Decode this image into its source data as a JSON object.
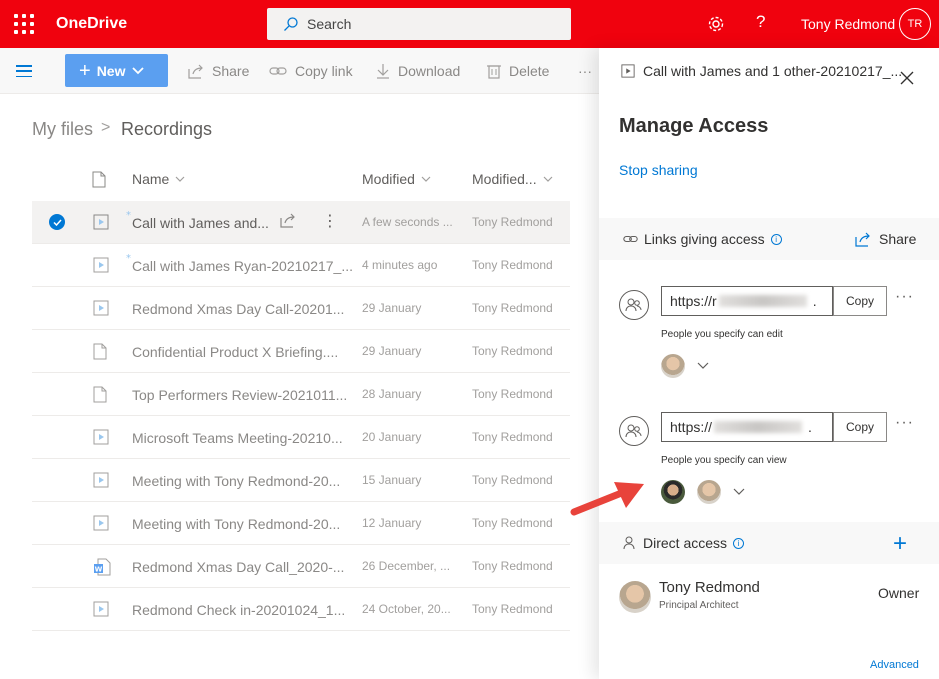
{
  "header": {
    "app_name": "OneDrive",
    "search_placeholder": "Search",
    "user_name": "Tony Redmond",
    "user_initials": "TR",
    "brand_color": "#f0020e"
  },
  "commandbar": {
    "new_label": "New",
    "share_label": "Share",
    "copy_link_label": "Copy link",
    "download_label": "Download",
    "delete_label": "Delete",
    "more_label": "···"
  },
  "breadcrumb": {
    "root": "My files",
    "separator": ">",
    "current": "Recordings"
  },
  "list": {
    "columns": {
      "name": "Name",
      "modified": "Modified",
      "modified_by": "Modified..."
    },
    "rows": [
      {
        "name": "Call with James and...",
        "modified": "A few seconds ...",
        "modified_by": "Tony Redmond",
        "icon": "video-file-icon",
        "selected": true
      },
      {
        "name": "Call with James Ryan-20210217_...",
        "modified": "4 minutes ago",
        "modified_by": "Tony Redmond",
        "icon": "video-file-icon"
      },
      {
        "name": "Redmond Xmas Day Call-20201...",
        "modified": "29 January",
        "modified_by": "Tony Redmond",
        "icon": "video-file-icon"
      },
      {
        "name": "Confidential Product X Briefing....",
        "modified": "29 January",
        "modified_by": "Tony Redmond",
        "icon": "document-file-icon"
      },
      {
        "name": "Top Performers Review-2021011...",
        "modified": "28 January",
        "modified_by": "Tony Redmond",
        "icon": "document-file-icon"
      },
      {
        "name": "Microsoft Teams Meeting-20210...",
        "modified": "20 January",
        "modified_by": "Tony Redmond",
        "icon": "video-file-icon"
      },
      {
        "name": "Meeting with Tony Redmond-20...",
        "modified": "15 January",
        "modified_by": "Tony Redmond",
        "icon": "video-file-icon"
      },
      {
        "name": "Meeting with Tony Redmond-20...",
        "modified": "12 January",
        "modified_by": "Tony Redmond",
        "icon": "video-file-icon"
      },
      {
        "name": "Redmond Xmas Day Call_2020-...",
        "modified": "26 December, ...",
        "modified_by": "Tony Redmond",
        "icon": "word-file-icon"
      },
      {
        "name": "Redmond Check in-20201024_1...",
        "modified": "24 October, 20...",
        "modified_by": "Tony Redmond",
        "icon": "video-file-icon"
      }
    ]
  },
  "panel": {
    "file_name": "Call with James and 1 other-20210217_...",
    "title": "Manage Access",
    "stop_sharing": "Stop sharing",
    "links_section": "Links giving access",
    "info_glyph": "i",
    "share_label": "Share",
    "links": [
      {
        "url_prefix": "https://r",
        "copy_label": "Copy",
        "description": "People you specify can edit",
        "more": "···"
      },
      {
        "url_prefix": "https://",
        "copy_label": "Copy",
        "description": "People you specify can view",
        "more": "···"
      }
    ],
    "direct_section": "Direct access",
    "owner": {
      "name": "Tony Redmond",
      "title": "Principal Architect",
      "role": "Owner"
    },
    "advanced": "Advanced"
  }
}
